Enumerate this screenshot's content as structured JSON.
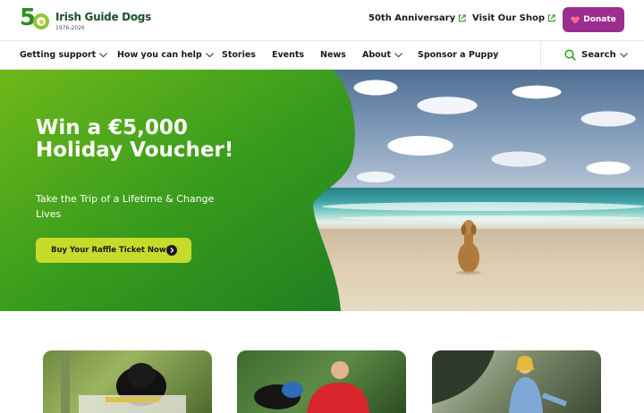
{
  "header": {
    "logo": {
      "number": "50",
      "name": "Irish Guide Dogs",
      "years": "1976-2026"
    },
    "links": [
      {
        "label": "50th Anniversary",
        "icon": "external-link-icon"
      },
      {
        "label": "Visit Our Shop",
        "icon": "external-link-icon"
      }
    ],
    "donate": {
      "label": "Donate",
      "icon": "heart-icon",
      "color": "#9b2d8f"
    }
  },
  "nav": {
    "items": [
      {
        "label": "Getting support",
        "dropdown": true
      },
      {
        "label": "How you can help",
        "dropdown": true
      },
      {
        "label": "Stories",
        "dropdown": false
      },
      {
        "label": "Events",
        "dropdown": false
      },
      {
        "label": "News",
        "dropdown": false
      },
      {
        "label": "About",
        "dropdown": true
      },
      {
        "label": "Sponsor a Puppy",
        "dropdown": false
      }
    ],
    "search": {
      "label": "Search",
      "icon": "search-icon"
    }
  },
  "hero": {
    "title": "Win a €5,000 Holiday Voucher!",
    "subtitle": "Take the Trip of a Lifetime & Change Lives",
    "button": {
      "label": "Buy Your Raffle Ticket Now!",
      "icon": "arrow-right-circle-icon",
      "color": "#c6dc2a"
    },
    "accent": "#2e9a1f"
  },
  "cards": [
    {
      "image": "guide-dog-black-labrador-photo"
    },
    {
      "image": "boy-with-guide-dog-photo"
    },
    {
      "image": "woman-by-sea-photo"
    }
  ]
}
